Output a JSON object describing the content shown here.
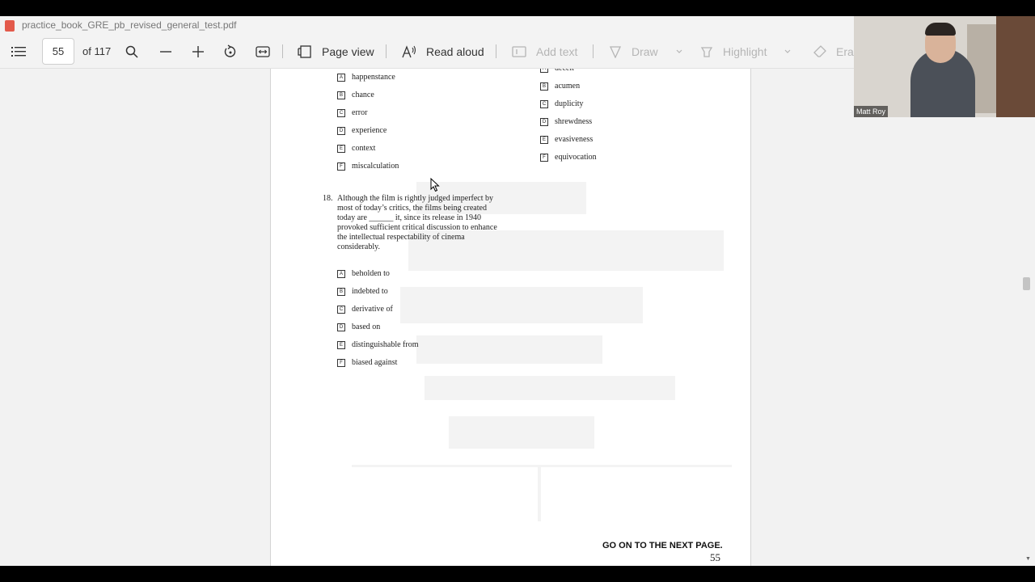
{
  "window": {
    "title": "practice_book_GRE_pb_revised_general_test.pdf"
  },
  "toolbar": {
    "page_number": "55",
    "page_total": "of 117",
    "page_view_label": "Page view",
    "read_aloud_label": "Read aloud",
    "add_text_label": "Add text",
    "draw_label": "Draw",
    "highlight_label": "Highlight",
    "erase_label": "Eras"
  },
  "document": {
    "q17_left_options": [
      {
        "letter": "A",
        "text": "happenstance"
      },
      {
        "letter": "B",
        "text": "chance"
      },
      {
        "letter": "C",
        "text": "error"
      },
      {
        "letter": "D",
        "text": "experience"
      },
      {
        "letter": "E",
        "text": "context"
      },
      {
        "letter": "F",
        "text": "miscalculation"
      }
    ],
    "q17_right_options": [
      {
        "letter": "A",
        "text": "deceit"
      },
      {
        "letter": "B",
        "text": "acumen"
      },
      {
        "letter": "C",
        "text": "duplicity"
      },
      {
        "letter": "D",
        "text": "shrewdness"
      },
      {
        "letter": "E",
        "text": "evasiveness"
      },
      {
        "letter": "F",
        "text": "equivocation"
      }
    ],
    "question18": {
      "number": "18.",
      "text": "Although the film is rightly judged imperfect by most of today’s critics, the films being created today are ______ it, since its release in 1940 provoked sufficient critical discussion to enhance the intellectual respectability of cinema considerably.",
      "options": [
        {
          "letter": "A",
          "text": "beholden to"
        },
        {
          "letter": "B",
          "text": "indebted to"
        },
        {
          "letter": "C",
          "text": "derivative of"
        },
        {
          "letter": "D",
          "text": "based on"
        },
        {
          "letter": "E",
          "text": "distinguishable from"
        },
        {
          "letter": "F",
          "text": "biased against"
        }
      ]
    },
    "footer_next": "GO ON TO THE NEXT PAGE.",
    "page_number": "55"
  },
  "webcam": {
    "name": "Matt Roy"
  }
}
